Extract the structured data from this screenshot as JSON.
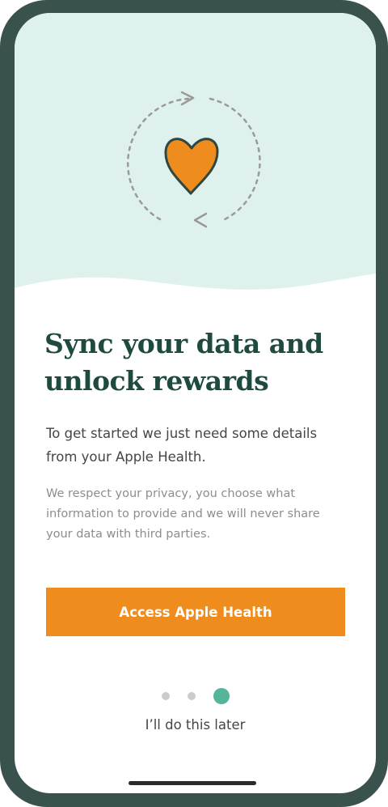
{
  "onboarding": {
    "title_line1": "Sync your data and",
    "title_line2": "unlock rewards",
    "lead_line1": "To get started we just need some details",
    "lead_line2": "from your Apple Health.",
    "privacy_line1": "We respect your privacy, you choose what",
    "privacy_line2": "information to provide and we will never share",
    "privacy_line3": "your data with third parties.",
    "cta_label": "Access Apple Health",
    "skip_label": "I’ll do this later"
  },
  "pager": {
    "total_pages": 3,
    "current_page": 3
  },
  "illustration": {
    "icon": "heart-sync-icon"
  },
  "colors": {
    "frame": "#3a524d",
    "hero_background": "#dff1ec",
    "title": "#1e4a3f",
    "accent": "#ee8c1e",
    "active_dot": "#55b49a",
    "inactive_dot": "#c8ccd1",
    "body_text": "#454545",
    "muted_text": "#8d8d8d"
  }
}
